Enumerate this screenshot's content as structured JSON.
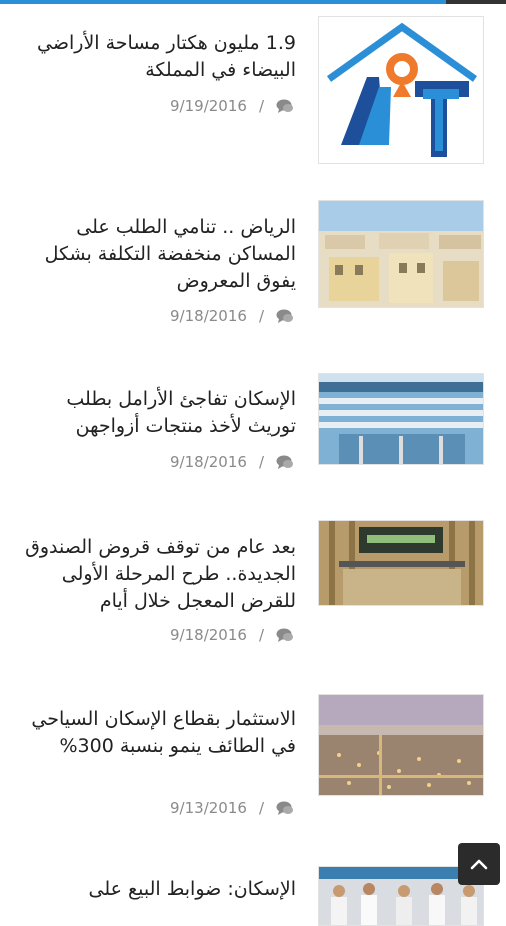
{
  "articles": [
    {
      "title": "1.9 مليون هكتار مساحة الأراضي البيضاء في المملكة",
      "date": "9/19/2016",
      "image": "logo-house-icon"
    },
    {
      "title": "الرياض .. تنامي الطلب على المساكن منخفضة التكلفة بشكل يفوق المعروض",
      "date": "9/18/2016",
      "image": "residential-buildings-photo"
    },
    {
      "title": "الإسكان تفاجئ الأرامل بطلب توريث لأخذ منتجات أزواجهن",
      "date": "9/18/2016",
      "image": "office-building-photo"
    },
    {
      "title": "بعد عام من توقف قروض الصندوق الجديدة.. طرح المرحلة الأولى للقرض المعجل خلال أيام",
      "date": "9/18/2016",
      "image": "fund-building-photo"
    },
    {
      "title": "الاستثمار بقطاع الإسكان السياحي في الطائف ينمو بنسبة 300%",
      "date": "9/13/2016",
      "image": "city-aerial-photo"
    },
    {
      "title": "الإسكان: ضوابط البيع على",
      "date": "",
      "image": "people-crowd-photo"
    }
  ],
  "meta_separator": "/",
  "icons": {
    "comment": "comment-icon",
    "scroll_top": "chevron-up-icon"
  },
  "colors": {
    "accent": "#2a8fd6"
  }
}
